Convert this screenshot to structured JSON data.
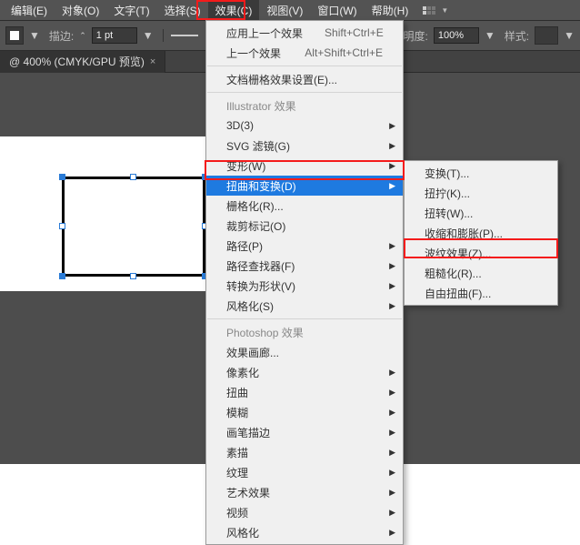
{
  "menubar": {
    "items": [
      "编辑(E)",
      "对象(O)",
      "文字(T)",
      "选择(S)",
      "效果(C)",
      "视图(V)",
      "窗口(W)",
      "帮助(H)"
    ]
  },
  "toolbar": {
    "strokeLabel": "描边:",
    "strokeValue": "1 pt",
    "opacityLabel": "明度:",
    "opacityValue": "100%",
    "styleLabel": "样式:"
  },
  "tab": {
    "title": "@ 400% (CMYK/GPU 预览)",
    "close": "×"
  },
  "mainmenu": {
    "applyLast": "应用上一个效果",
    "applyLastSc": "Shift+Ctrl+E",
    "prevEffect": "上一个效果",
    "prevEffectSc": "Alt+Shift+Ctrl+E",
    "docRaster": "文档栅格效果设置(E)...",
    "illHeader": "Illustrator 效果",
    "ill": {
      "a": "3D(3)",
      "b": "SVG 滤镜(G)",
      "c": "变形(W)",
      "d": "扭曲和变换(D)",
      "e": "栅格化(R)...",
      "f": "裁剪标记(O)",
      "g": "路径(P)",
      "h": "路径查找器(F)",
      "i": "转换为形状(V)",
      "j": "风格化(S)"
    },
    "psHeader": "Photoshop 效果",
    "ps": {
      "a": "效果画廊...",
      "b": "像素化",
      "c": "扭曲",
      "d": "模糊",
      "e": "画笔描边",
      "f": "素描",
      "g": "纹理",
      "h": "艺术效果",
      "i": "视频",
      "j": "风格化"
    }
  },
  "submenu": {
    "a": "变换(T)...",
    "b": "扭拧(K)...",
    "c": "扭转(W)...",
    "d": "收缩和膨胀(P)...",
    "e": "波纹效果(Z)...",
    "f": "粗糙化(R)...",
    "g": "自由扭曲(F)..."
  }
}
